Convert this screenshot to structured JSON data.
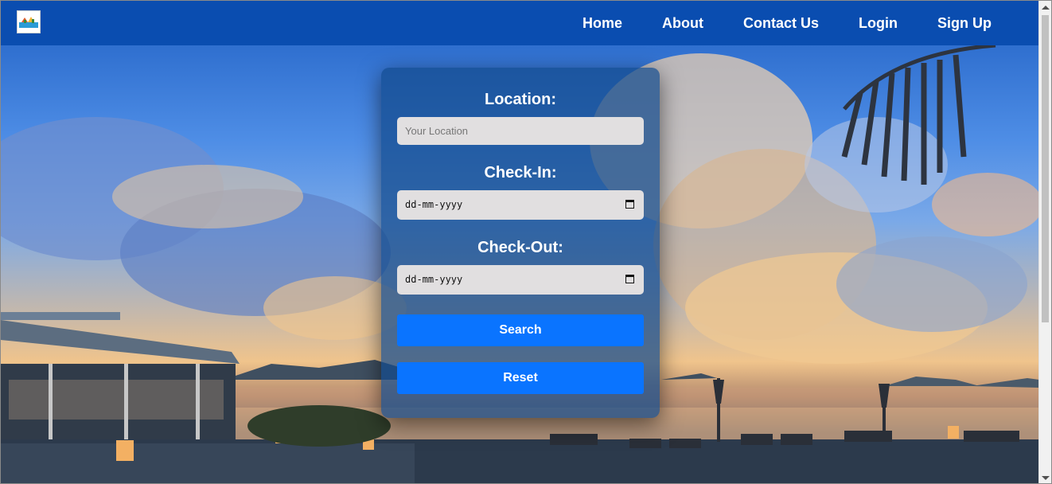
{
  "nav": {
    "logo_icon": "resort-logo-icon",
    "links": [
      {
        "label": "Home"
      },
      {
        "label": "About"
      },
      {
        "label": "Contact Us"
      },
      {
        "label": "Login"
      },
      {
        "label": "Sign Up"
      }
    ]
  },
  "form": {
    "location": {
      "label": "Location:",
      "placeholder": "Your Location",
      "value": ""
    },
    "check_in": {
      "label": "Check-In:",
      "display": "dd-mm-yyyy",
      "icon": "calendar-icon"
    },
    "check_out": {
      "label": "Check-Out:",
      "display": "dd-mm-yyyy",
      "icon": "calendar-icon"
    },
    "search_label": "Search",
    "reset_label": "Reset"
  },
  "colors": {
    "navbar": "#0a4db0",
    "button": "#0a74ff",
    "input_bg": "#e1dfe0",
    "card_bg": "rgba(18,74,140,0.72)"
  }
}
